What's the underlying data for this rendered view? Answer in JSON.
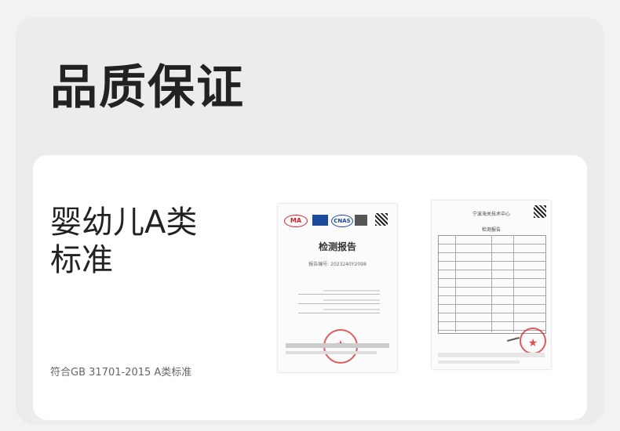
{
  "page": {
    "title": "品质保证"
  },
  "card": {
    "title_line1": "婴幼儿A类",
    "title_line2": "标准",
    "subtitle": "符合GB 31701-2015 A类标准"
  },
  "report1": {
    "logo_ma": "MA",
    "logo_cnas": "CNAS",
    "heading": "检测报告",
    "report_no": "报告编号: 2023240Y2098"
  },
  "report2": {
    "heading": "宁波海关技术中心",
    "title": "检测报告"
  },
  "colors": {
    "accent": "#222222",
    "seal": "#d22828",
    "card_bg": "#ffffff",
    "outer_bg": "#ececec"
  }
}
